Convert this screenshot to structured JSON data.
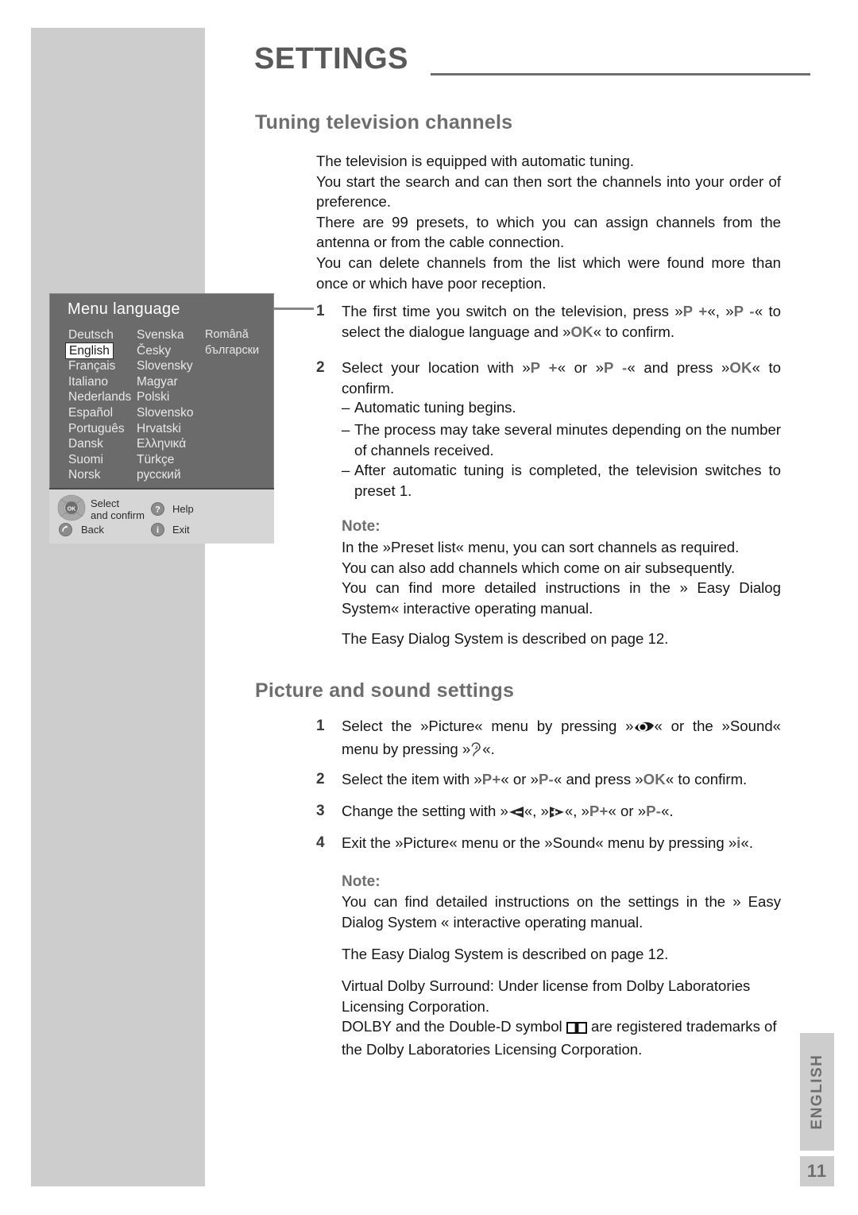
{
  "header": {
    "title": "SETTINGS"
  },
  "sections": {
    "tuning": {
      "heading": "Tuning television channels",
      "intro": [
        "The television is equipped with automatic tuning.",
        "You start the search and can then sort the channels into your order of preference.",
        "There are 99 presets, to which you can assign channels from the antenna or from the cable connection.",
        "You can delete channels from the list which were found more than once or which have poor reception."
      ],
      "steps": [
        {
          "num": "1",
          "parts": [
            {
              "t": "text",
              "v": "The first time you switch on the television, press »"
            },
            {
              "t": "key",
              "v": "P +"
            },
            {
              "t": "text",
              "v": "«, »"
            },
            {
              "t": "key",
              "v": "P -"
            },
            {
              "t": "text",
              "v": "« to select the dialogue language and »"
            },
            {
              "t": "key",
              "v": "OK"
            },
            {
              "t": "text",
              "v": "« to confirm."
            }
          ]
        },
        {
          "num": "2",
          "parts": [
            {
              "t": "text",
              "v": "Select your location with »"
            },
            {
              "t": "key",
              "v": "P +"
            },
            {
              "t": "text",
              "v": "« or »"
            },
            {
              "t": "key",
              "v": "P -"
            },
            {
              "t": "text",
              "v": "« and press »"
            },
            {
              "t": "key",
              "v": "OK"
            },
            {
              "t": "text",
              "v": "« to confirm."
            }
          ]
        }
      ],
      "substeps": [
        "Automatic tuning begins.",
        "The process may take several minutes depending on the number of channels received.",
        "After automatic tuning is completed, the television switches to preset 1."
      ],
      "dash_glyph": "–",
      "note_label": "Note:",
      "note_body": [
        "In the »Preset list« menu, you can sort channels as required.",
        "You can also add channels which come on air subsequently.",
        "You can find more detailed instructions in the » Easy Dialog System« interactive operating manual."
      ],
      "eds_line": "The Easy Dialog System is described on page 12."
    },
    "picture": {
      "heading": "Picture and sound settings",
      "steps": [
        {
          "num": "1",
          "parts": [
            {
              "t": "text",
              "v": "Select the »Picture« menu by pressing »"
            },
            {
              "t": "icon",
              "v": "eye-icon"
            },
            {
              "t": "text",
              "v": "« or the »Sound« menu by pressing »"
            },
            {
              "t": "icon",
              "v": "ear-icon"
            },
            {
              "t": "text",
              "v": "«."
            }
          ]
        },
        {
          "num": "2",
          "parts": [
            {
              "t": "text",
              "v": "Select the item with »"
            },
            {
              "t": "key",
              "v": "P+"
            },
            {
              "t": "text",
              "v": "« or »"
            },
            {
              "t": "key",
              "v": "P-"
            },
            {
              "t": "text",
              "v": "« and press »"
            },
            {
              "t": "key",
              "v": "OK"
            },
            {
              "t": "text",
              "v": "« to confirm."
            }
          ]
        },
        {
          "num": "3",
          "parts": [
            {
              "t": "text",
              "v": "Change the setting with »"
            },
            {
              "t": "icon",
              "v": "arrow-left-minus-icon"
            },
            {
              "t": "text",
              "v": "«, »"
            },
            {
              "t": "icon",
              "v": "arrow-right-plus-icon"
            },
            {
              "t": "text",
              "v": "«, »"
            },
            {
              "t": "key",
              "v": "P+"
            },
            {
              "t": "text",
              "v": "« or »"
            },
            {
              "t": "key",
              "v": "P-"
            },
            {
              "t": "text",
              "v": "«."
            }
          ]
        },
        {
          "num": "4",
          "parts": [
            {
              "t": "text",
              "v": "Exit the »Picture« menu or the »Sound« menu by pressing »"
            },
            {
              "t": "key",
              "v": "i"
            },
            {
              "t": "text",
              "v": "«."
            }
          ]
        }
      ],
      "note_label": "Note:",
      "note_body": [
        "You can find detailed instructions on the settings in the » Easy Dialog System « interactive operating manual."
      ],
      "eds_line": "The Easy Dialog System is described on page 12.",
      "dolby": {
        "line1": "Virtual Dolby Surround: Under license from Dolby Laboratories Licensing Corporation.",
        "line2_a": "DOLBY and the Double-D symbol",
        "line2_icon": "dolby-double-d-icon",
        "line2_b": "are registered trademarks of the Dolby Laboratories Licensing Corporation."
      }
    }
  },
  "osd": {
    "title": "Menu language",
    "columns": [
      [
        "Deutsch",
        "English",
        "Français",
        "Italiano",
        "Nederlands",
        "Español",
        "Português",
        "Dansk",
        "Suomi",
        "Norsk"
      ],
      [
        "Svenska",
        "Česky",
        "Slovensky",
        "Magyar",
        "Polski",
        "Slovensko",
        "Hrvatski",
        "Ελληνικά",
        "Türkçe",
        "русский"
      ],
      [
        "Română",
        "български"
      ]
    ],
    "selected": "English",
    "footer": {
      "select_line1": "Select",
      "select_line2": "and confirm",
      "back": "Back",
      "help": "Help",
      "exit": "Exit",
      "ok_label": "OK"
    }
  },
  "footer": {
    "language_tab": "ENGLISH",
    "page_number": "11"
  },
  "colors": {
    "heading_grey": "#6e6e6e",
    "band_grey": "#cdcdcd",
    "osd_bg": "#6b6b6b",
    "osd_footer": "#d6d6d6",
    "body_text": "#161616"
  }
}
